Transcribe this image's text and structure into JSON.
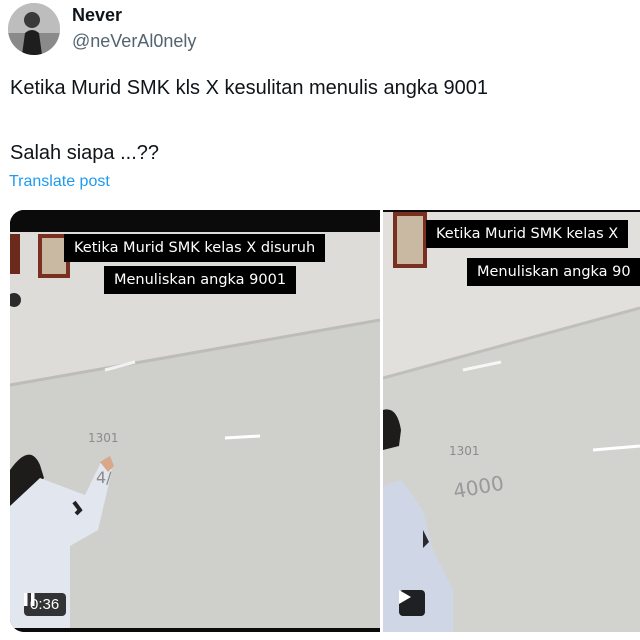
{
  "author": {
    "display_name": "Never",
    "handle": "@neVerAl0nely"
  },
  "tweet": {
    "line1": "Ketika Murid SMK kls X kesulitan menulis angka 9001",
    "line2": "Salah siapa ...??",
    "translate_label": "Translate post"
  },
  "media": [
    {
      "caption_line1": "Ketika Murid SMK kelas X disuruh",
      "caption_line2": "Menuliskan angka 9001",
      "board_text_top": "1301",
      "board_text_bottom": "4/",
      "duration": "0:36",
      "control": "pause-icon"
    },
    {
      "caption_line1": "Ketika Murid SMK kelas X",
      "caption_line2": "Menuliskan angka 90",
      "board_text_top": "1301",
      "board_text_bottom": "4000",
      "control": "play-icon"
    }
  ],
  "colors": {
    "link": "#1d9bf0",
    "secondary": "#536471",
    "primary": "#0f1419"
  }
}
